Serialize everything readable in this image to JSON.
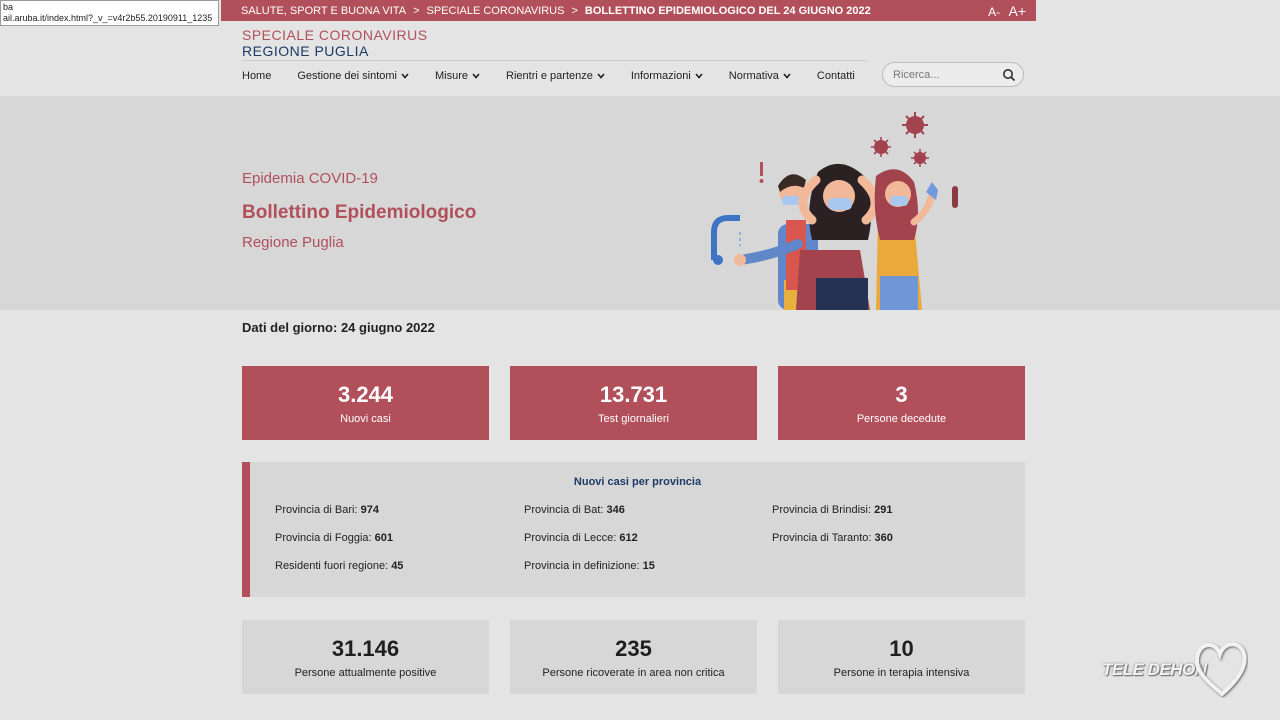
{
  "url_tooltip": {
    "line1": "ba",
    "line2": "ail.aruba.it/index.html?_v_=v4r2b55.20190911_1235"
  },
  "topbar": {
    "crumbs": [
      "SALUTE, SPORT E BUONA VITA",
      "SPECIALE CORONAVIRUS",
      "BOLLETTINO EPIDEMIOLOGICO DEL 24 GIUGNO 2022"
    ],
    "separator": ">",
    "font_small": "A-",
    "font_large": "A+"
  },
  "brand": {
    "line1": "SPECIALE CORONAVIRUS",
    "line2": "REGIONE PUGLIA"
  },
  "nav": {
    "items": [
      {
        "label": "Home"
      },
      {
        "label": "Gestione dei sintomi",
        "has_dropdown": true
      },
      {
        "label": "Misure",
        "has_dropdown": true
      },
      {
        "label": "Rientri e partenze",
        "has_dropdown": true
      },
      {
        "label": "Informazioni",
        "has_dropdown": true
      },
      {
        "label": "Normativa",
        "has_dropdown": true
      },
      {
        "label": "Contatti"
      }
    ],
    "chevron": "❯"
  },
  "search": {
    "placeholder": "Ricerca..."
  },
  "hero": {
    "kicker": "Epidemia COVID-19",
    "title": "Bollettino Epidemiologico",
    "subtitle": "Regione Puglia"
  },
  "day": "Dati del giorno: 24 giugno 2022",
  "top_stats": [
    {
      "value": "3.244",
      "label": "Nuovi casi"
    },
    {
      "value": "13.731",
      "label": "Test giornalieri"
    },
    {
      "value": "3",
      "label": "Persone decedute"
    }
  ],
  "province": {
    "title": "Nuovi casi per provincia",
    "rows": [
      {
        "label": "Provincia di Bari:",
        "value": "974"
      },
      {
        "label": "Provincia di Bat:",
        "value": "346"
      },
      {
        "label": "Provincia di Brindisi:",
        "value": "291"
      },
      {
        "label": "Provincia di Foggia:",
        "value": "601"
      },
      {
        "label": "Provincia di Lecce:",
        "value": "612"
      },
      {
        "label": "Provincia di Taranto:",
        "value": "360"
      },
      {
        "label": "Residenti fuori regione:",
        "value": "45"
      },
      {
        "label": "Provincia in definizione:",
        "value": "15"
      }
    ]
  },
  "bottom_stats": [
    {
      "value": "31.146",
      "label": "Persone attualmente positive"
    },
    {
      "value": "235",
      "label": "Persone ricoverate in area non critica"
    },
    {
      "value": "10",
      "label": "Persone in terapia intensiva"
    }
  ],
  "watermark": "TELE DEHON",
  "colors": {
    "accent": "#b1505a",
    "navy": "#1c3b66",
    "panel": "#d7d7d7",
    "page": "#e4e4e4"
  }
}
